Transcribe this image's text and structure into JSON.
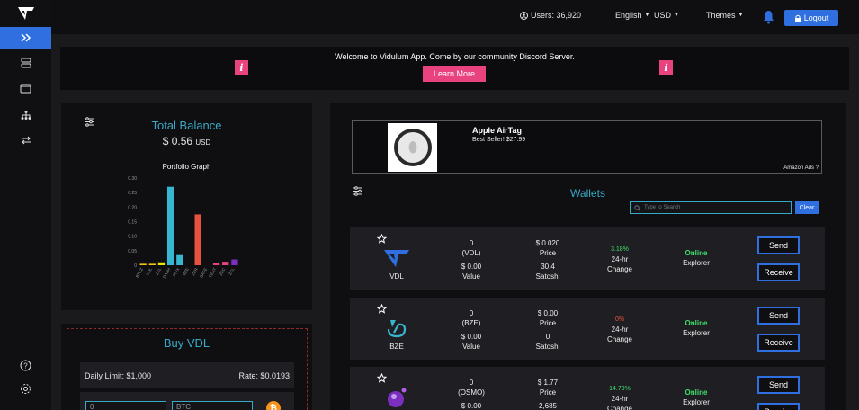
{
  "topbar": {
    "users_label": "Users: 36,920",
    "language": "English",
    "currency": "USD",
    "themes": "Themes",
    "logout": "Logout"
  },
  "banner": {
    "text": "Welcome to Vidulum App. Come by our community Discord Server.",
    "button": "Learn More",
    "info_glyph": "i"
  },
  "total_balance": {
    "title": "Total Balance",
    "amount": "$ 0.56",
    "unit": "USD",
    "graph_title": "Portfolio Graph"
  },
  "chart_data": {
    "type": "bar",
    "title": "Portfolio Graph",
    "categories": [
      "BTCZ",
      "VDL",
      "ZEL",
      "DASH",
      "PIVX",
      "BZE",
      "ZER",
      "SAFE",
      "TENT",
      "ZEC",
      "ZCL"
    ],
    "values": [
      0.005,
      0.005,
      0.01,
      0.27,
      0.035,
      0.0,
      0.175,
      0.0,
      0.008,
      0.012,
      0.02
    ],
    "colors": [
      "#f0c419",
      "#f0c419",
      "#e6e600",
      "#39b6cf",
      "#39b6cf",
      "#888888",
      "#e8533f",
      "#888888",
      "#e8437f",
      "#e8437f",
      "#7b2fbf"
    ],
    "yticks": [
      "0",
      "0.05",
      "0.10",
      "0.15",
      "0.20",
      "0.25",
      "0.30"
    ],
    "ylim": [
      0,
      0.3
    ]
  },
  "buy": {
    "title": "Buy VDL",
    "daily_limit": "Daily Limit: $1,000",
    "rate": "Rate: $0.0193",
    "input1": "0",
    "input2": "BTC",
    "btc_glyph": "₿"
  },
  "ad": {
    "title": "Apple AirTag",
    "subtitle": "Best Seller! $27.99",
    "footer": "Amazon Ads ?"
  },
  "wallets": {
    "title": "Wallets",
    "search_placeholder": "Type to Search",
    "clear": "Clear",
    "col_price": "Price",
    "col_satoshi": "Satoshi",
    "col_value": "Value",
    "col_24hr": "24-hr",
    "col_change": "Change",
    "col_explorer": "Explorer",
    "online": "Online",
    "send": "Send",
    "receive": "Receive",
    "rows": [
      {
        "name": "VDL",
        "amount": "0",
        "ticker": "(VDL)",
        "value": "$ 0.00",
        "price": "$ 0.020",
        "satoshi": "30.4",
        "change": "3.18%",
        "change_color": "#3fe06a"
      },
      {
        "name": "BZE",
        "amount": "0",
        "ticker": "(BZE)",
        "value": "$ 0.00",
        "price": "$ 0.00",
        "satoshi": "0",
        "change": "0%",
        "change_color": "#e8533f"
      },
      {
        "name": "OSMO",
        "amount": "0",
        "ticker": "(OSMO)",
        "value": "$ 0.00",
        "price": "$ 1.77",
        "satoshi": "2,685",
        "change": "14.79%",
        "change_color": "#3fe06a"
      }
    ]
  }
}
